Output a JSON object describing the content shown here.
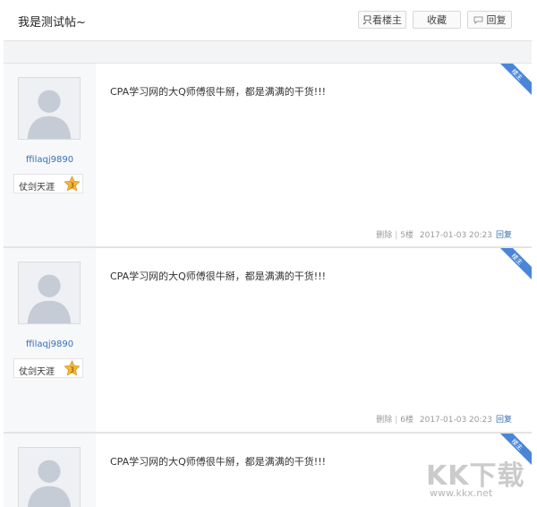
{
  "header": {
    "title": "我是测试帖~",
    "only_owner": "只看楼主",
    "favorite": "收藏",
    "reply": "回复"
  },
  "posts": [
    {
      "badge": "楼主",
      "username": "ffilaqj9890",
      "level_title": "仗剑天涯",
      "level_num": "3",
      "content": "CPA学习网的大Q师傅很牛掰，都是满满的干货!!!",
      "delete": "删除",
      "floor": "5楼",
      "time": "2017-01-03 20:23",
      "reply": "回复"
    },
    {
      "badge": "楼主",
      "username": "ffilaqj9890",
      "level_title": "仗剑天涯",
      "level_num": "3",
      "content": "CPA学习网的大Q师傅很牛掰，都是满满的干货!!!",
      "delete": "删除",
      "floor": "6楼",
      "time": "2017-01-03 20:23",
      "reply": "回复"
    },
    {
      "badge": "楼主",
      "content": "CPA学习网的大Q师傅很牛掰，都是满满的干货!!!"
    }
  ],
  "watermark": {
    "brand": "KK下载",
    "url": "www.kkx.net"
  },
  "colors": {
    "accent": "#3a6fb5",
    "badge": "#4a86d8",
    "star": "#f4b83a"
  }
}
